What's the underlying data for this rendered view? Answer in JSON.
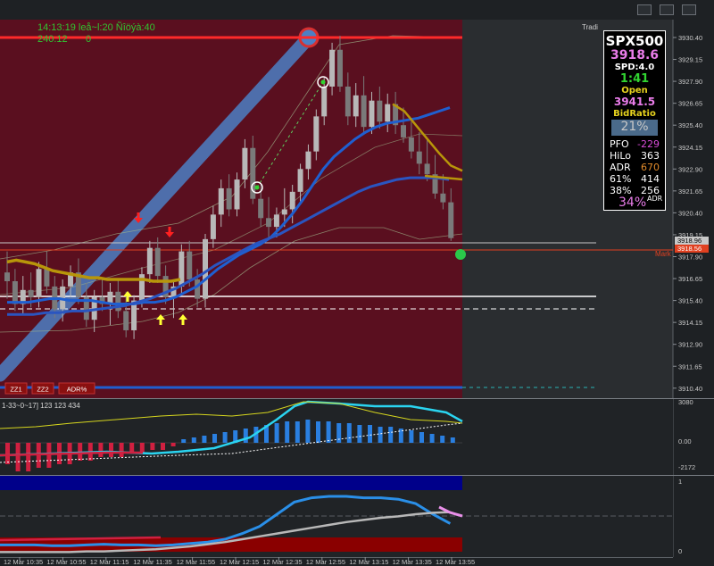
{
  "header": {
    "time_line": "14:13:19 leå~l:20 Ñîöýà:40",
    "values_line": "240.12",
    "zero": "0",
    "trade_label": "Tradi"
  },
  "panel": {
    "symbol": "SPX500",
    "price": "3918.6",
    "spd": "SPD:4.0",
    "timer": "1:41",
    "open_label": "Open",
    "open_value": "3941.5",
    "bid_ratio_label": "BidRatio",
    "bid_ratio_value": "21%",
    "rows": [
      {
        "label": "PFO",
        "value": "-229",
        "color": "#d84cd8"
      },
      {
        "label": "HiLo",
        "value": "363",
        "color": "#ffffff"
      },
      {
        "label": "ADR",
        "value": "670",
        "color": "#e08a2a"
      },
      {
        "label": "61%",
        "value": "414",
        "color": "#ffffff"
      },
      {
        "label": "38%",
        "value": "256",
        "color": "#ffffff"
      }
    ],
    "adr_pct": "34%",
    "adr_suffix": "ADR"
  },
  "buttons": [
    "ZZ1",
    "ZZ2",
    "ADR%"
  ],
  "mark_label": "Mark",
  "sub1_label": "1-33~0~17] 123 123 434",
  "colors": {
    "main_bg": "#5a0f1f",
    "right_bg": "#2a2d30",
    "up_candle": "#b8b8b8",
    "down_candle": "#7a7a7a",
    "blue_ma": "#1f5fd0",
    "gold_ma": "#b8960a",
    "red_line": "#ff2020",
    "orange_line": "#e04020"
  },
  "chart_data": [
    {
      "type": "candlestick",
      "title": "",
      "y_axis_ticks": [
        3930.4,
        3929.15,
        3927.9,
        3926.65,
        3925.4,
        3924.15,
        3922.9,
        3921.65,
        3920.4,
        3919.15,
        3917.9,
        3916.65,
        3915.4,
        3914.15,
        3912.9,
        3911.65,
        3910.4
      ],
      "price_labels": [
        "3918.96",
        "3918.56"
      ],
      "ylim": [
        3910.4,
        3930.4
      ],
      "x_axis_ticks": [
        "12 Mar 10:35",
        "12 Mar 10:55",
        "12 Mar 11:15",
        "12 Mar 11:35",
        "12 Mar 11:55",
        "12 Mar 12:15",
        "12 Mar 12:35",
        "12 Mar 12:55",
        "12 Mar 13:15",
        "12 Mar 13:35",
        "12 Mar 13:55"
      ],
      "candles": [
        [
          3917.0,
          3918.2,
          3915.5,
          3916.5
        ],
        [
          3916.5,
          3917.2,
          3914.8,
          3915.2
        ],
        [
          3915.2,
          3916.8,
          3914.6,
          3916.0
        ],
        [
          3916.0,
          3917.0,
          3915.0,
          3915.6
        ],
        [
          3915.6,
          3917.6,
          3915.0,
          3917.2
        ],
        [
          3917.2,
          3918.2,
          3915.8,
          3916.2
        ],
        [
          3916.2,
          3916.8,
          3914.4,
          3914.9
        ],
        [
          3914.9,
          3916.6,
          3914.2,
          3916.2
        ],
        [
          3916.2,
          3917.4,
          3915.6,
          3917.0
        ],
        [
          3917.0,
          3917.8,
          3915.2,
          3915.6
        ],
        [
          3915.6,
          3916.4,
          3913.9,
          3914.3
        ],
        [
          3914.3,
          3916.0,
          3913.6,
          3915.6
        ],
        [
          3915.6,
          3916.6,
          3914.8,
          3915.2
        ],
        [
          3915.2,
          3916.4,
          3914.0,
          3915.9
        ],
        [
          3915.9,
          3916.6,
          3914.4,
          3914.8
        ],
        [
          3914.8,
          3915.9,
          3913.3,
          3913.7
        ],
        [
          3913.7,
          3915.7,
          3913.2,
          3915.4
        ],
        [
          3915.4,
          3917.3,
          3915.0,
          3916.9
        ],
        [
          3916.9,
          3918.8,
          3916.4,
          3918.4
        ],
        [
          3918.4,
          3919.0,
          3916.4,
          3916.8
        ],
        [
          3916.8,
          3917.4,
          3915.2,
          3915.6
        ],
        [
          3915.6,
          3916.6,
          3914.4,
          3916.2
        ],
        [
          3916.2,
          3918.6,
          3915.8,
          3918.2
        ],
        [
          3918.2,
          3918.8,
          3916.2,
          3916.6
        ],
        [
          3916.6,
          3917.2,
          3915.0,
          3915.5
        ],
        [
          3915.5,
          3919.2,
          3915.0,
          3918.9
        ],
        [
          3918.9,
          3920.8,
          3918.4,
          3920.3
        ],
        [
          3920.3,
          3922.3,
          3919.6,
          3921.8
        ],
        [
          3921.8,
          3922.6,
          3920.2,
          3920.6
        ],
        [
          3920.6,
          3922.7,
          3920.2,
          3922.3
        ],
        [
          3922.3,
          3924.6,
          3921.8,
          3924.1
        ],
        [
          3924.1,
          3924.8,
          3920.9,
          3921.2
        ],
        [
          3921.2,
          3922.0,
          3919.6,
          3920.1
        ],
        [
          3920.1,
          3921.3,
          3919.0,
          3919.6
        ],
        [
          3919.6,
          3920.7,
          3919.0,
          3920.3
        ],
        [
          3920.3,
          3921.8,
          3919.6,
          3920.6
        ],
        [
          3920.6,
          3922.0,
          3919.8,
          3921.6
        ],
        [
          3921.6,
          3923.2,
          3921.0,
          3922.9
        ],
        [
          3922.9,
          3924.3,
          3922.3,
          3923.9
        ],
        [
          3923.9,
          3926.3,
          3923.4,
          3925.9
        ],
        [
          3925.9,
          3928.1,
          3925.4,
          3927.6
        ],
        [
          3927.6,
          3930.1,
          3927.1,
          3929.7
        ],
        [
          3929.7,
          3930.5,
          3927.3,
          3927.6
        ],
        [
          3927.6,
          3928.4,
          3925.4,
          3925.9
        ],
        [
          3925.9,
          3927.8,
          3925.3,
          3927.1
        ],
        [
          3927.1,
          3928.2,
          3924.9,
          3925.3
        ],
        [
          3925.3,
          3927.3,
          3924.9,
          3926.8
        ],
        [
          3926.8,
          3927.6,
          3925.2,
          3925.6
        ],
        [
          3925.6,
          3927.2,
          3925.0,
          3926.6
        ],
        [
          3926.6,
          3927.3,
          3924.9,
          3925.4
        ],
        [
          3925.4,
          3926.4,
          3924.4,
          3924.7
        ],
        [
          3924.7,
          3925.6,
          3923.5,
          3923.9
        ],
        [
          3923.9,
          3925.0,
          3922.6,
          3923.2
        ],
        [
          3923.2,
          3924.6,
          3922.2,
          3922.6
        ],
        [
          3922.6,
          3923.7,
          3921.2,
          3921.5
        ],
        [
          3921.5,
          3922.6,
          3920.6,
          3921.0
        ],
        [
          3921.0,
          3921.8,
          3918.8,
          3918.96
        ]
      ],
      "series": [
        {
          "name": "",
          "role": "blue_ma",
          "values": [
            3915.3,
            3915.3,
            3915.3,
            3915.4,
            3915.5,
            3915.5,
            3915.4,
            3915.4,
            3915.4,
            3915.3,
            3915.2,
            3915.2,
            3915.2,
            3915.3,
            3915.3,
            3915.4,
            3915.6,
            3915.9,
            3916.2,
            3916.7,
            3917.2,
            3917.6,
            3918.0,
            3918.3,
            3918.6,
            3919.0,
            3919.6,
            3920.3,
            3921.1,
            3922.0,
            3922.9,
            3923.6,
            3924.1,
            3924.6,
            3925.0,
            3925.3,
            3925.5,
            3925.6,
            3925.7,
            3925.8,
            3926.0,
            3926.2,
            3926.4
          ]
        },
        {
          "name": "",
          "role": "gold_ma",
          "values": [
            3926.6,
            3926.2,
            3925.4,
            3924.6,
            3923.8,
            3923.1,
            3922.8
          ]
        }
      ]
    },
    {
      "type": "bar",
      "title": "",
      "label": "1-33~0~17] 123 123 434",
      "y_axis_ticks": [
        3080,
        0.0,
        -2172
      ],
      "values": [
        -0.6,
        -0.8,
        -0.8,
        -0.7,
        -0.7,
        -0.6,
        -0.6,
        -0.5,
        -0.5,
        -0.4,
        -0.4,
        -0.4,
        -0.3,
        -0.3,
        -0.2,
        -0.2,
        -0.1,
        0.1,
        0.15,
        0.2,
        0.25,
        0.3,
        0.35,
        0.4,
        0.45,
        0.5,
        0.55,
        0.6,
        0.6,
        0.65,
        0.6,
        0.6,
        0.55,
        0.55,
        0.5,
        0.5,
        0.45,
        0.45,
        0.4,
        0.35,
        0.3,
        0.25,
        0.2,
        0.15
      ]
    },
    {
      "type": "line",
      "title": "",
      "y_axis_ticks": [
        1,
        0
      ],
      "series": [
        {
          "name": "",
          "role": "blue",
          "values": [
            0.12,
            0.12,
            0.12,
            0.11,
            0.11,
            0.12,
            0.13,
            0.12,
            0.12,
            0.11,
            0.12,
            0.14,
            0.16,
            0.2,
            0.28,
            0.38,
            0.55,
            0.72,
            0.78,
            0.8,
            0.8,
            0.78,
            0.78,
            0.76,
            0.7,
            0.55,
            0.42
          ]
        },
        {
          "name": "",
          "role": "grey",
          "values": [
            0.02,
            0.02,
            0.02,
            0.02,
            0.02,
            0.03,
            0.03,
            0.04,
            0.05,
            0.06,
            0.08,
            0.1,
            0.13,
            0.16,
            0.2,
            0.24,
            0.28,
            0.32,
            0.36,
            0.4,
            0.44,
            0.47,
            0.5,
            0.52,
            0.55,
            0.57,
            0.58
          ]
        }
      ]
    }
  ]
}
